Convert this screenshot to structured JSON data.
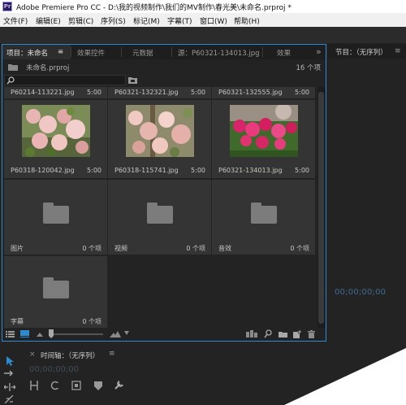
{
  "window": {
    "app_icon_label": "Pr",
    "title": "Adobe Premiere Pro CC - D:\\我的视频制作\\我们的MV制作\\春光美\\未命名.prproj *"
  },
  "menu": [
    "文件(F)",
    "编辑(E)",
    "剪辑(C)",
    "序列(S)",
    "标记(M)",
    "字幕(T)",
    "窗口(W)",
    "帮助(H)"
  ],
  "project_panel": {
    "tabs": [
      "项目：未命名",
      "效果控件",
      "元数据",
      "源：P60321-134013.jpg",
      "效果"
    ],
    "tab_menu_glyph": "≡",
    "overflow_glyph": "»",
    "file_name": "未命名.prproj",
    "item_count": "16 个项",
    "items": [
      {
        "name": "P60214-113221.jpg",
        "meta": "5:00",
        "kind": "clip-partial"
      },
      {
        "name": "P60321-132321.jpg",
        "meta": "5:00",
        "kind": "clip-partial"
      },
      {
        "name": "P60321-132555.jpg",
        "meta": "5:00",
        "kind": "clip-partial"
      },
      {
        "name": "P60318-120042.jpg",
        "meta": "5:00",
        "kind": "clip-blossom"
      },
      {
        "name": "P60318-115741.jpg",
        "meta": "5:00",
        "kind": "clip-blossom2"
      },
      {
        "name": "P60321-134013.jpg",
        "meta": "5:00",
        "kind": "clip-red"
      },
      {
        "name": "图片",
        "meta": "0 个项",
        "kind": "bin"
      },
      {
        "name": "视频",
        "meta": "0 个项",
        "kind": "bin"
      },
      {
        "name": "音效",
        "meta": "0 个项",
        "kind": "bin"
      },
      {
        "name": "字幕",
        "meta": "0 个项",
        "kind": "bin"
      }
    ]
  },
  "program_panel": {
    "title": "节目：（无序列）",
    "menu_glyph": "≡",
    "timecode": "00;00;00;00"
  },
  "timeline_panel": {
    "close_glyph": "×",
    "title": "时间轴：（无序列）",
    "menu_glyph": "≡",
    "timecode": "00;00;00;00"
  },
  "icons": {
    "search": "search-icon",
    "new_bin": "new-bin-icon",
    "list_view": "list-view-icon",
    "icon_view": "icon-view-icon",
    "find": "find-icon",
    "new_item": "new-item-icon",
    "trash": "trash-icon",
    "selection_tool": "selection-tool-icon",
    "ripple_tool": "ripple-edit-tool-icon",
    "razor_tool": "razor-tool-icon",
    "wrench": "wrench-icon"
  },
  "colors": {
    "focus_border": "#2c8bd1",
    "panel_bg": "#232323",
    "cell_bg": "#343434",
    "timecode_blue": "#3d6b8e"
  }
}
